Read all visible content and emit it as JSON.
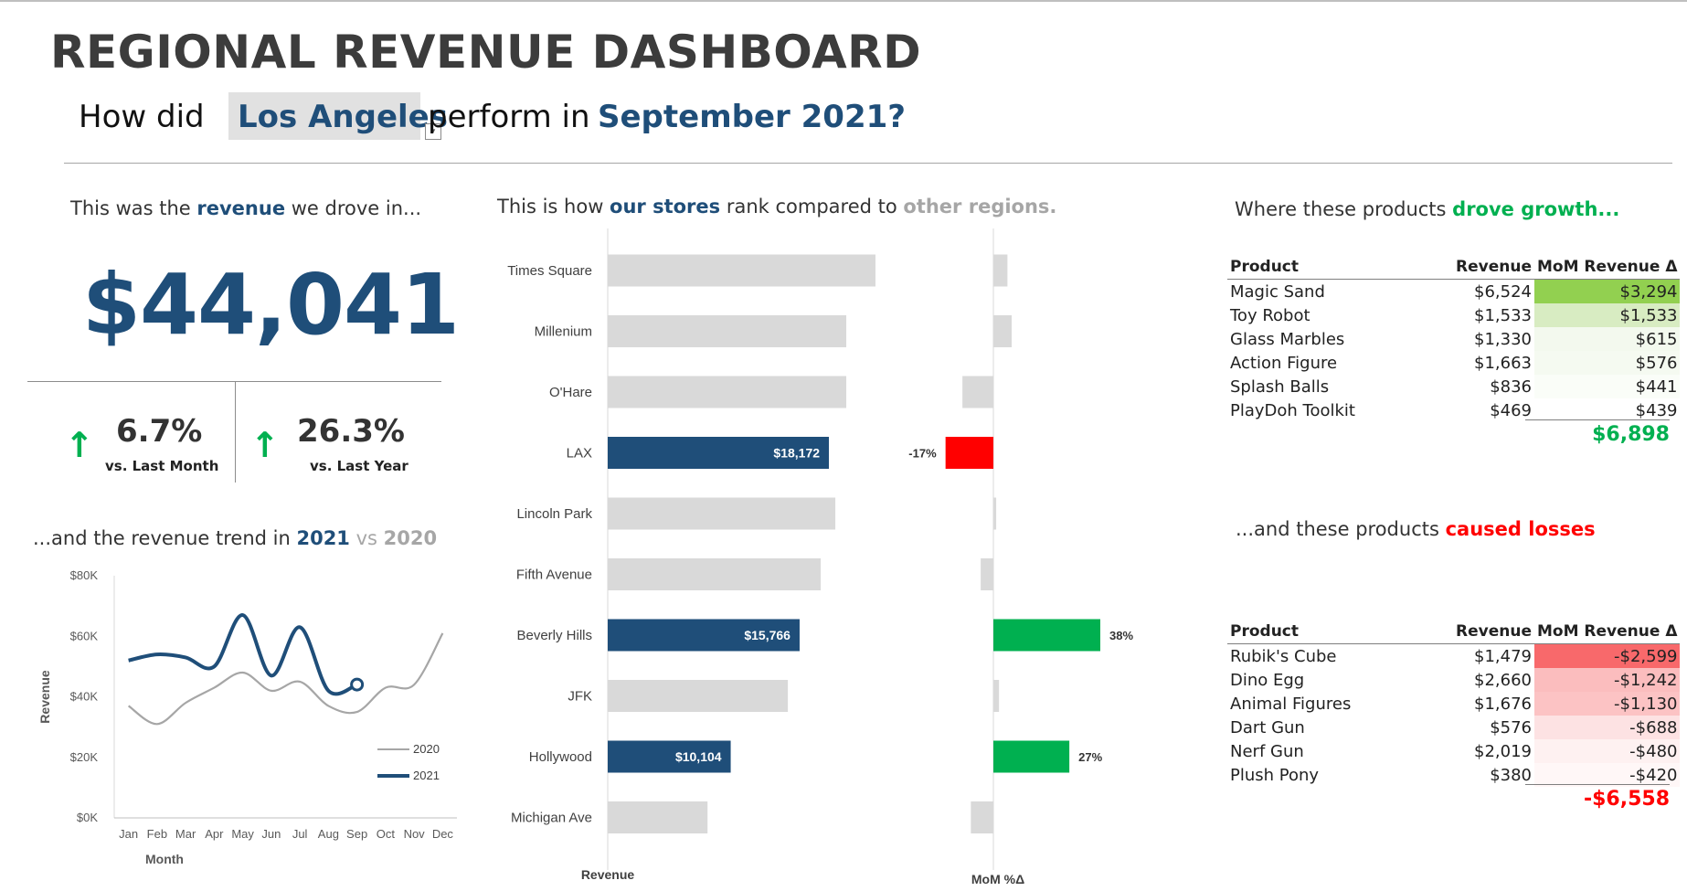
{
  "title": "REGIONAL REVENUE DASHBOARD",
  "question": {
    "prefix": "How did",
    "region": "Los Angeles",
    "middle": "perform in",
    "period": "September 2021?"
  },
  "revenue_section": {
    "lead": "This was the ",
    "highlight": "revenue",
    "tail": " we drove in..."
  },
  "kpi": {
    "revenue": "$44,041",
    "mom_pct": "6.7%",
    "mom_label": "vs. Last Month",
    "yoy_pct": "26.3%",
    "yoy_label": "vs. Last Year",
    "arrow": "↑"
  },
  "trend_section": {
    "lead": "...and the revenue trend in ",
    "y1": "2021",
    "mid": " vs ",
    "y2": "2020"
  },
  "rank_section": {
    "lead": "This is how ",
    "highlight": "our stores",
    "mid": " rank compared to ",
    "grey": "other regions."
  },
  "growth_section": {
    "lead": "Where these products ",
    "highlight": "drove growth..."
  },
  "loss_section": {
    "lead": "...and these products ",
    "highlight": "caused losses"
  },
  "colors": {
    "brand": "#1f4e79",
    "bar_grey": "#d9d9d9",
    "green": "#00b050",
    "red": "#ff0000"
  },
  "chart_data": [
    {
      "type": "line",
      "title": "",
      "xlabel": "Month",
      "ylabel": "Revenue",
      "categories": [
        "Jan",
        "Feb",
        "Mar",
        "Apr",
        "May",
        "Jun",
        "Jul",
        "Aug",
        "Sep",
        "Oct",
        "Nov",
        "Dec"
      ],
      "y_ticks": [
        "$0K",
        "$20K",
        "$40K",
        "$60K",
        "$80K"
      ],
      "ylim": [
        0,
        80000
      ],
      "legend_position": "bottom-right",
      "series": [
        {
          "name": "2020",
          "color": "#a6a6a6",
          "values": [
            37000,
            31000,
            38000,
            43000,
            48000,
            42000,
            45000,
            37000,
            35000,
            43000,
            44000,
            61000
          ]
        },
        {
          "name": "2021",
          "color": "#1f4e79",
          "values": [
            52000,
            54000,
            53000,
            50000,
            67000,
            47000,
            63000,
            42000,
            44041,
            null,
            null,
            null
          ]
        }
      ]
    },
    {
      "type": "bar",
      "orientation": "horizontal",
      "xlabel": "Revenue",
      "categories": [
        "Times Square",
        "Millenium",
        "O'Hare",
        "LAX",
        "Lincoln Park",
        "Fifth Avenue",
        "Beverly Hills",
        "JFK",
        "Hollywood",
        "Michigan Ave"
      ],
      "values": [
        22000,
        19600,
        19600,
        18172,
        18700,
        17500,
        15766,
        14800,
        10104,
        8200
      ],
      "highlighted": [
        "LAX",
        "Beverly Hills",
        "Hollywood"
      ],
      "value_labels": {
        "LAX": "$18,172",
        "Beverly Hills": "$15,766",
        "Hollywood": "$10,104"
      }
    },
    {
      "type": "bar",
      "orientation": "horizontal",
      "xlabel": "MoM %Δ",
      "categories": [
        "Times Square",
        "Millenium",
        "O'Hare",
        "LAX",
        "Lincoln Park",
        "Fifth Avenue",
        "Beverly Hills",
        "JFK",
        "Hollywood",
        "Michigan Ave"
      ],
      "values": [
        0.05,
        0.065,
        -0.11,
        -0.17,
        0.01,
        -0.045,
        0.38,
        0.02,
        0.27,
        -0.08
      ],
      "value_labels": {
        "LAX": "-17%",
        "Beverly Hills": "38%",
        "Hollywood": "27%"
      }
    }
  ],
  "growth_table": {
    "headers": [
      "Product",
      "Revenue",
      "MoM Revenue Δ"
    ],
    "rows": [
      {
        "product": "Magic Sand",
        "revenue": "$6,524",
        "delta": "$3,294",
        "bg": "#92d050"
      },
      {
        "product": "Toy Robot",
        "revenue": "$1,533",
        "delta": "$1,533",
        "bg": "#d8ecc2"
      },
      {
        "product": "Glass Marbles",
        "revenue": "$1,330",
        "delta": "$615",
        "bg": "#f3f9ee"
      },
      {
        "product": "Action Figure",
        "revenue": "$1,663",
        "delta": "$576",
        "bg": "#f5faf1"
      },
      {
        "product": "Splash Balls",
        "revenue": "$836",
        "delta": "$441",
        "bg": "#fafdf8"
      },
      {
        "product": "PlayDoh Toolkit",
        "revenue": "$469",
        "delta": "$439",
        "bg": "#ffffff"
      }
    ],
    "total": "$6,898"
  },
  "loss_table": {
    "headers": [
      "Product",
      "Revenue",
      "MoM Revenue Δ"
    ],
    "rows": [
      {
        "product": "Rubik's Cube",
        "revenue": "$1,479",
        "delta": "-$2,599",
        "bg": "#f8696b"
      },
      {
        "product": "Dino Egg",
        "revenue": "$2,660",
        "delta": "-$1,242",
        "bg": "#fbbdbe"
      },
      {
        "product": "Animal Figures",
        "revenue": "$1,676",
        "delta": "-$1,130",
        "bg": "#fcc3c4"
      },
      {
        "product": "Dart Gun",
        "revenue": "$576",
        "delta": "-$688",
        "bg": "#fde2e3"
      },
      {
        "product": "Nerf Gun",
        "revenue": "$2,019",
        "delta": "-$480",
        "bg": "#fef1f1"
      },
      {
        "product": "Plush Pony",
        "revenue": "$380",
        "delta": "-$420",
        "bg": "#fff7f7"
      }
    ],
    "total": "-$6,558"
  }
}
